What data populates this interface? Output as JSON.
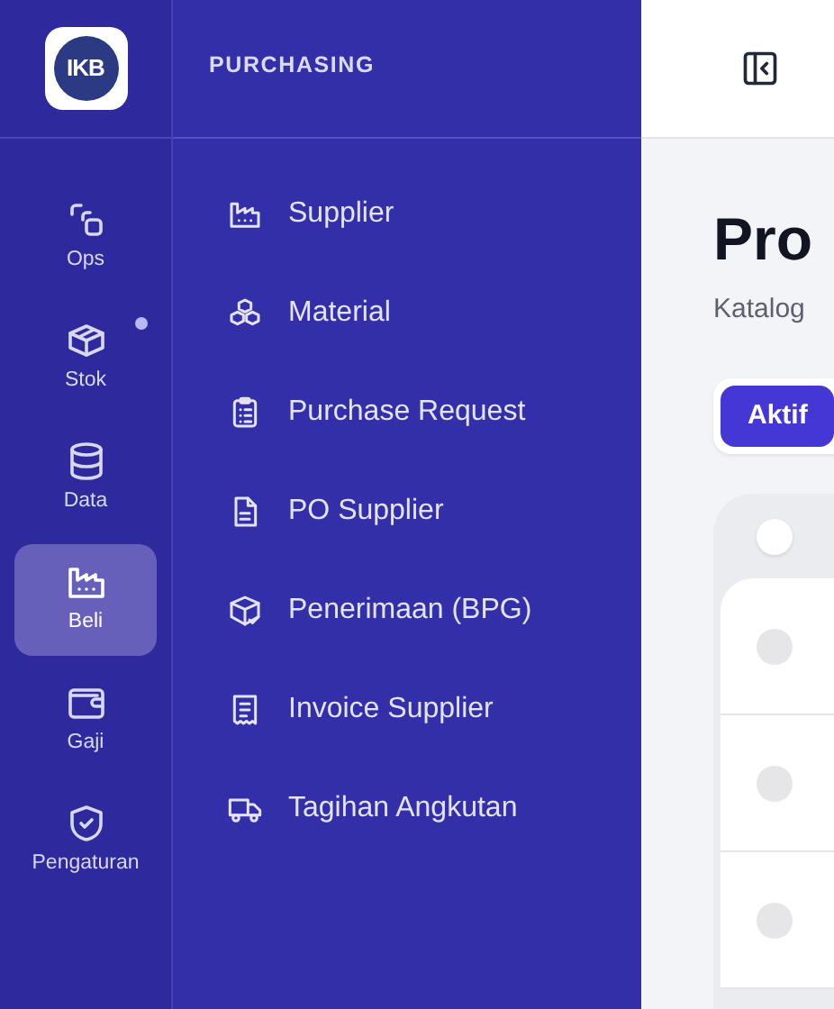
{
  "logo": {
    "text": "IKB"
  },
  "rail": [
    {
      "label": "Ops",
      "kind": "ops",
      "selected": false,
      "dot": false
    },
    {
      "label": "Stok",
      "kind": "box",
      "selected": false,
      "dot": true
    },
    {
      "label": "Data",
      "kind": "database",
      "selected": false,
      "dot": false
    },
    {
      "label": "Beli",
      "kind": "factory",
      "selected": true,
      "dot": false
    },
    {
      "label": "Gaji",
      "kind": "wallet",
      "selected": false,
      "dot": false
    },
    {
      "label": "Pengaturan",
      "kind": "shield",
      "selected": false,
      "dot": false
    }
  ],
  "panel": {
    "title": "PURCHASING",
    "items": [
      {
        "label": "Supplier",
        "kind": "factory"
      },
      {
        "label": "Material",
        "kind": "cubes"
      },
      {
        "label": "Purchase Request",
        "kind": "clipboard"
      },
      {
        "label": "PO Supplier",
        "kind": "document"
      },
      {
        "label": "Penerimaan (BPG)",
        "kind": "package"
      },
      {
        "label": "Invoice Supplier",
        "kind": "receipt"
      },
      {
        "label": "Tagihan Angkutan",
        "kind": "truck"
      }
    ]
  },
  "main": {
    "title": "Pro",
    "subtitle": "Katalog",
    "tabs": [
      {
        "label": "Aktif",
        "selected": true
      }
    ],
    "table": {
      "header_checked": false,
      "rows": [
        {
          "checked": false
        },
        {
          "checked": false
        },
        {
          "checked": false
        }
      ]
    }
  }
}
